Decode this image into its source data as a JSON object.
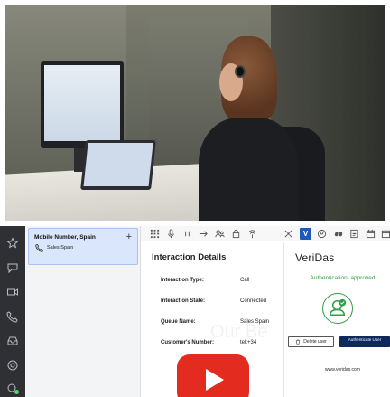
{
  "conversations": {
    "items": [
      {
        "title": "Mobile Number, Spain",
        "subtitle": "Sales Spain",
        "add_label": "+"
      }
    ]
  },
  "toolbar": {
    "icons": [
      "grid-icon",
      "mic-icon",
      "pause-icon",
      "transfer-arrow-icon",
      "consult-icon",
      "lock-icon",
      "voicemail-icon",
      "network-icon",
      "veridas-app-icon",
      "contacts-icon",
      "quote-icon",
      "notes-icon",
      "calendar-icon"
    ],
    "active_app_label": "V"
  },
  "interaction": {
    "title": "Interaction Details",
    "rows": [
      {
        "label": "Interaction Type:",
        "value": "Call"
      },
      {
        "label": "Interaction State:",
        "value": "Connected"
      },
      {
        "label": "Queue Name:",
        "value": "Sales Spain"
      },
      {
        "label": "Customer's Number:",
        "value": "tel:+34"
      }
    ],
    "watermark": "Our Be"
  },
  "veridas": {
    "logo": "VeriDas",
    "status": "Authentication: approved",
    "delete_label": "Delete user",
    "authenticate_label": "Authenticate User",
    "url": "www.veridas.com",
    "status_color": "#2f9e44",
    "button_color": "#0e2a5c"
  },
  "video": {
    "play_icon": "youtube-play-icon",
    "color": "#e32b1f"
  },
  "rail": {
    "icons": [
      "star-icon",
      "chat-icon",
      "video-icon",
      "phone-icon",
      "inbox-icon",
      "help-icon",
      "status-icon"
    ]
  }
}
